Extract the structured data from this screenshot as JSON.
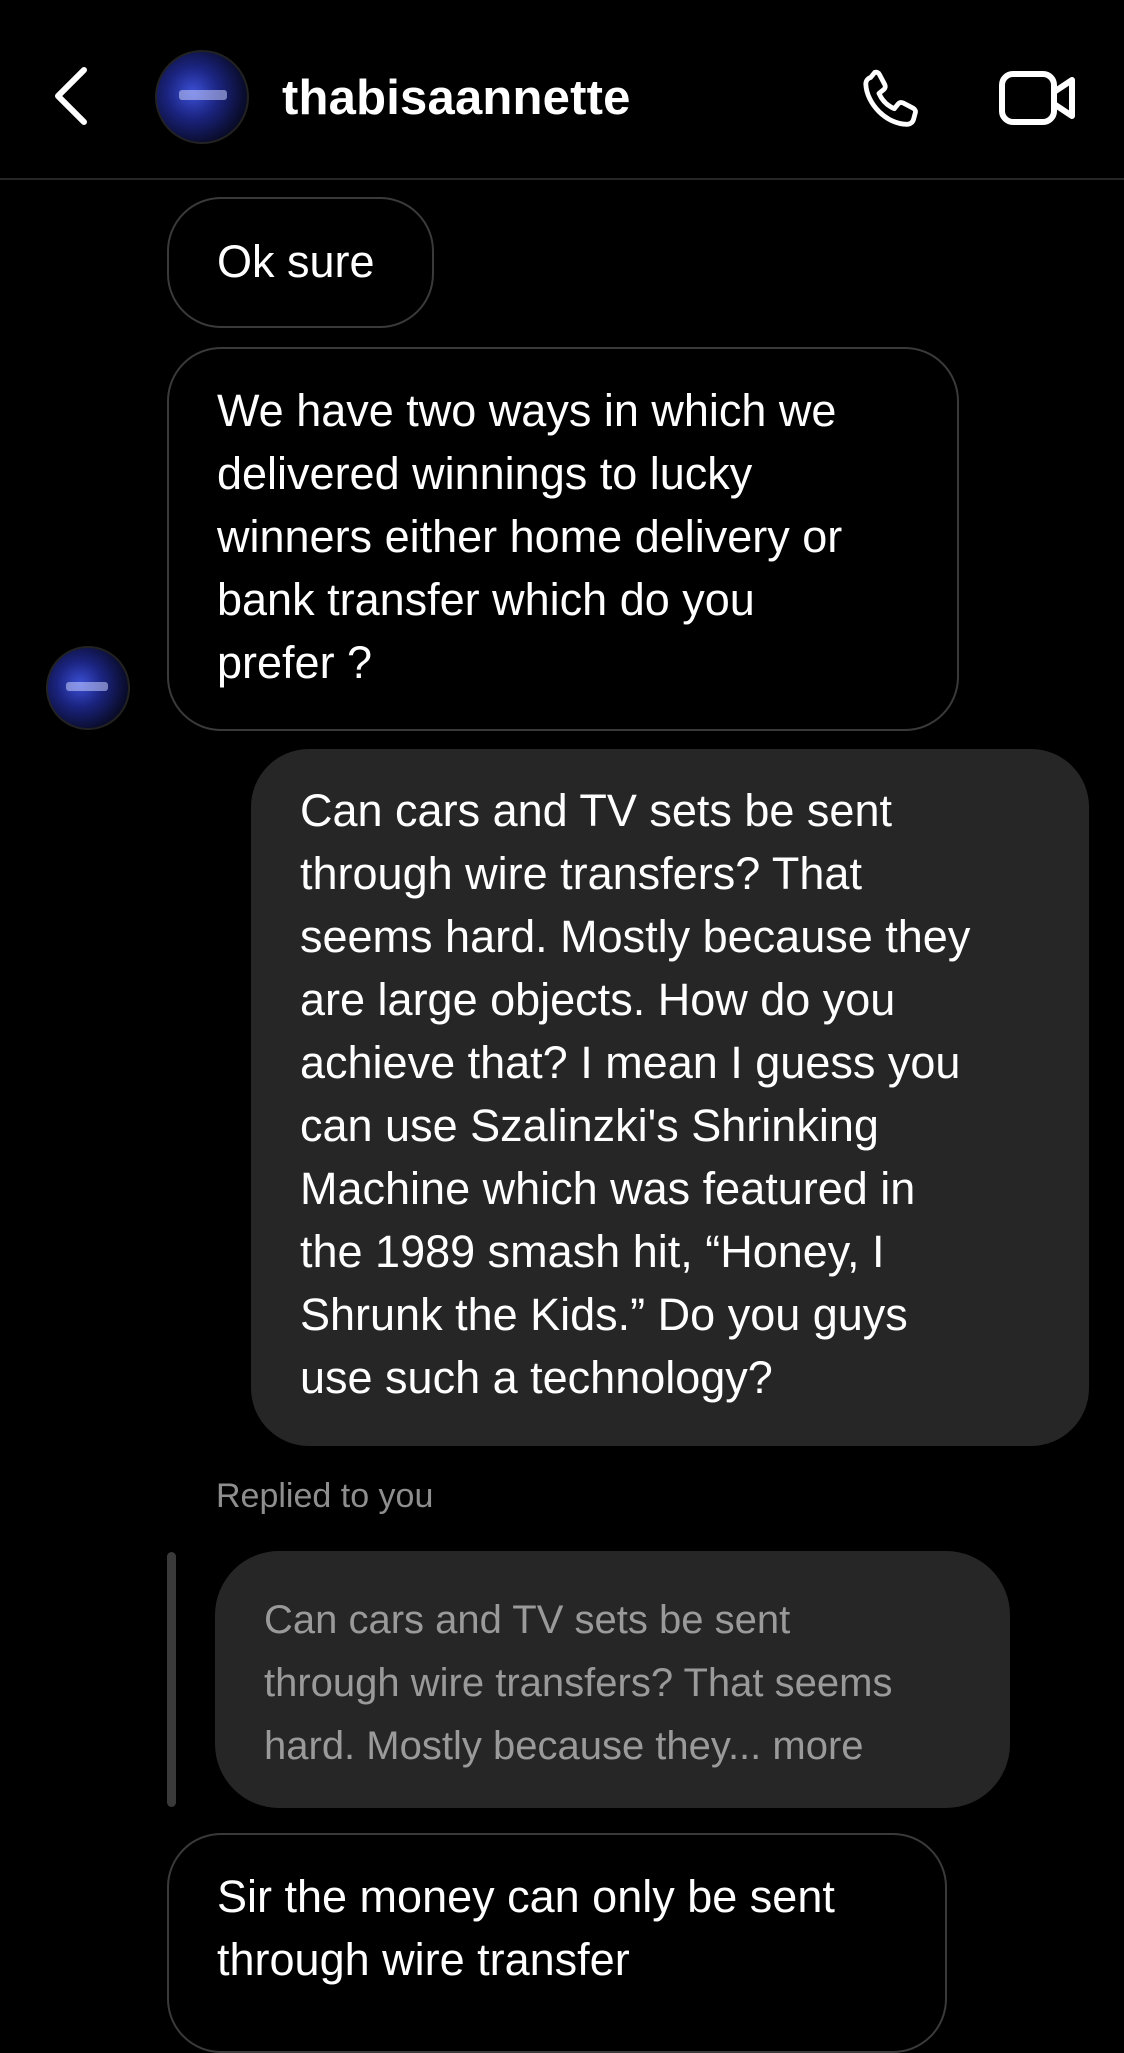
{
  "header": {
    "username": "thabisaannette",
    "back_icon": "chevron-left-icon",
    "call_icon": "phone-icon",
    "video_icon": "video-camera-icon"
  },
  "messages": [
    {
      "direction": "incoming",
      "lines": [
        "Ok sure"
      ]
    },
    {
      "direction": "incoming",
      "lines": [
        "We have two ways in which we",
        "delivered winnings to lucky",
        "winners either home delivery or",
        "bank transfer which do you",
        "prefer ?"
      ]
    },
    {
      "direction": "outgoing",
      "lines": [
        "Can cars and TV sets be sent",
        "through wire transfers? That",
        "seems hard. Mostly because they",
        "are large objects. How do you",
        "achieve that? I mean I guess you",
        "can use Szalinzki's Shrinking",
        "Machine which was featured in",
        "the 1989 smash hit, “Honey, I",
        "Shrunk the Kids.” Do you guys",
        "use such a technology?"
      ]
    },
    {
      "direction": "incoming",
      "lines": [
        "Sir the money can only be sent",
        "through wire transfer"
      ]
    }
  ],
  "reply": {
    "label": "Replied to you",
    "quoted_lines": [
      "Can cars and TV sets be sent",
      "through wire transfers? That seems",
      "hard. Mostly because they... more"
    ]
  },
  "colors": {
    "background": "#000000",
    "outgoing_bubble": "#262626",
    "incoming_border": "#3a3a3a",
    "muted_text": "#8e8e8e"
  }
}
